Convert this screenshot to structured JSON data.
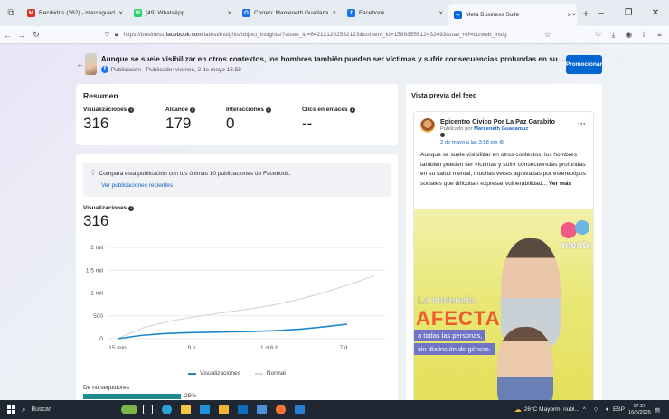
{
  "browser": {
    "tabs": [
      {
        "title": "Recibidos (362) - marceguadam",
        "fav": "M",
        "color": "#d93025",
        "active": false
      },
      {
        "title": "(49) WhatsApp",
        "fav": "W",
        "color": "#25d366",
        "active": false
      },
      {
        "title": "Correo: Marceneth Guadamuz",
        "fav": "O",
        "color": "#1a73e8",
        "active": false
      },
      {
        "title": "Facebook",
        "fav": "f",
        "color": "#1877f2",
        "active": false
      },
      {
        "title": "Meta Business Suite",
        "fav": "∞",
        "color": "#0668e1",
        "active": true
      }
    ],
    "url_prefix": "https://business.",
    "url_domain": "facebook.com",
    "url_rest": "/latest/insights/object_insights/?asset_id=642121202532123&content_id=1589355512432493&nav_ref=bizweb_insig"
  },
  "header": {
    "title": "Aunque se suele visibilizar en otros contextos, los hombres también pueden ser víctimas y sufrir consecuencias profundas en su ...",
    "subtitle": "Publicación · Publicado: viernes, 2 de mayo 15:58",
    "promote_label": "Promocionar"
  },
  "summary": {
    "heading": "Resumen",
    "metrics": [
      {
        "label": "Visualizaciones",
        "value": "316"
      },
      {
        "label": "Alcance",
        "value": "179"
      },
      {
        "label": "Interacciones",
        "value": "0"
      },
      {
        "label": "Clics en enlaces",
        "value": "--"
      }
    ]
  },
  "compare": {
    "text": "Compara esta publicación con tus últimas 10 publicaciones de Facebook.",
    "link": "Ver publicaciones recientes"
  },
  "views": {
    "label": "Visualizaciones",
    "value": "316"
  },
  "chart_data": {
    "type": "line",
    "y_ticks": [
      "0",
      "500",
      "1 mil",
      "1,5 mil",
      "2 mil"
    ],
    "x_ticks": [
      "15 min",
      "9 h",
      "1 d 6 h",
      "7 d"
    ],
    "ylim": [
      0,
      2000
    ],
    "series": [
      {
        "name": "Visualizaciones",
        "color": "#1e88c7",
        "values": [
          0,
          70,
          110,
          130,
          140,
          150,
          160,
          180,
          210,
          260,
          316
        ]
      },
      {
        "name": "Normal",
        "color": "#d4d7dc",
        "values": [
          0,
          240,
          380,
          480,
          560,
          640,
          730,
          850,
          1000,
          1180,
          1380
        ]
      }
    ]
  },
  "segment": {
    "label": "De no seguidores",
    "pct": "25%",
    "fraction": 0.25
  },
  "preview": {
    "heading": "Vista previa del feed",
    "page_name": "Epicentro Cívico Por La Paz Garabito",
    "by_prefix": "Publicado por ",
    "by_name": "Marceneth Guadamuz",
    "date": "2 de mayo a las 3:58 pm",
    "text": "Aunque se suele visibilizar en otros contextos, los hombres también pueden ser víctimas y sufrir consecuencias profundas en su salud mental, muchas veces agravadas por estereotipos sociales que dificultan expresar vulnerabilidad... ",
    "more": "Ver más",
    "img_line1": "La violencia",
    "img_line2": "AFECTA",
    "img_line3": "a todas las personas,",
    "img_line4": "sin distinción de género.",
    "img_logo": "mente"
  },
  "taskbar": {
    "search": "Buscar",
    "weather": "26°C  Mayorm. nubl...",
    "lang": "ESP",
    "time": "17:29",
    "date": "16/5/2025"
  }
}
